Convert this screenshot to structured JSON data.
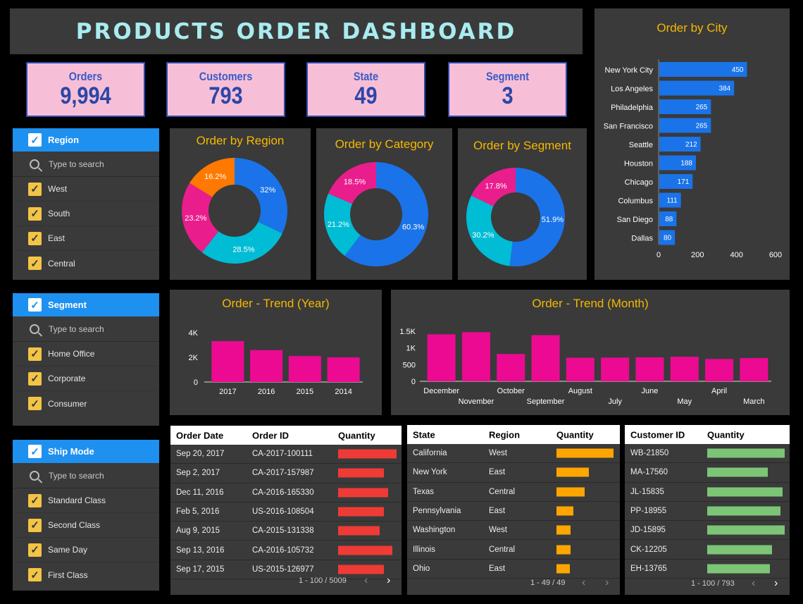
{
  "header": {
    "title": "PRODUCTS ORDER DASHBOARD"
  },
  "kpis": [
    {
      "label": "Orders",
      "value": "9,994"
    },
    {
      "label": "Customers",
      "value": "793"
    },
    {
      "label": "State",
      "value": "49"
    },
    {
      "label": "Segment",
      "value": "3"
    }
  ],
  "filters": {
    "region": {
      "title": "Region",
      "search_placeholder": "Type to search",
      "items": [
        "West",
        "South",
        "East",
        "Central"
      ]
    },
    "segment": {
      "title": "Segment",
      "search_placeholder": "Type to search",
      "items": [
        "Home Office",
        "Corporate",
        "Consumer"
      ]
    },
    "shipmode": {
      "title": "Ship Mode",
      "search_placeholder": "Type to search",
      "items": [
        "Standard Class",
        "Second Class",
        "Same Day",
        "First Class"
      ]
    }
  },
  "colors": {
    "blue": "#1a73e8",
    "teal": "#00bcd4",
    "pink": "#e91e8c",
    "orange": "#ff7900",
    "accent": "#f5b800",
    "bar_pink": "#ec0a93",
    "red_bar": "#ef3b36",
    "orange_bar": "#ffa500",
    "green_bar": "#7cc576"
  },
  "chart_data": [
    {
      "type": "pie",
      "title": "Order by Region",
      "slices": [
        {
          "label": "32%",
          "value": 32,
          "color": "#1a73e8"
        },
        {
          "label": "28.5%",
          "value": 28.5,
          "color": "#00bcd4"
        },
        {
          "label": "23.2%",
          "value": 23.2,
          "color": "#e91e8c"
        },
        {
          "label": "16.2%",
          "value": 16.2,
          "color": "#ff7900"
        }
      ]
    },
    {
      "type": "pie",
      "title": "Order by Category",
      "slices": [
        {
          "label": "60.3%",
          "value": 60.3,
          "color": "#1a73e8"
        },
        {
          "label": "21.2%",
          "value": 21.2,
          "color": "#00bcd4"
        },
        {
          "label": "18.5%",
          "value": 18.5,
          "color": "#e91e8c"
        }
      ]
    },
    {
      "type": "pie",
      "title": "Order by Segment",
      "slices": [
        {
          "label": "51.9%",
          "value": 51.9,
          "color": "#1a73e8"
        },
        {
          "label": "30.2%",
          "value": 30.2,
          "color": "#00bcd4"
        },
        {
          "label": "17.8%",
          "value": 17.8,
          "color": "#e91e8c"
        }
      ]
    },
    {
      "type": "bar",
      "title": "Order by City",
      "orientation": "horizontal",
      "categories": [
        "New York City",
        "Los Angeles",
        "Philadelphia",
        "San Francisco",
        "Seattle",
        "Houston",
        "Chicago",
        "Columbus",
        "San Diego",
        "Dallas"
      ],
      "values": [
        450,
        384,
        265,
        265,
        212,
        188,
        171,
        111,
        88,
        80
      ],
      "xlim": [
        0,
        600
      ],
      "ticks": [
        "0",
        "200",
        "400",
        "600"
      ]
    },
    {
      "type": "bar",
      "title": "Order - Trend (Year)",
      "categories": [
        "2017",
        "2016",
        "2015",
        "2014"
      ],
      "values": [
        3312,
        2587,
        2102,
        1993
      ],
      "ylim": [
        0,
        4000
      ],
      "ticks": [
        "0",
        "2K",
        "4K"
      ]
    },
    {
      "type": "bar",
      "title": "Order - Trend (Month)",
      "categories": [
        "December",
        "November",
        "October",
        "September",
        "August",
        "July",
        "June",
        "May",
        "April",
        "March"
      ],
      "values": [
        1408,
        1471,
        819,
        1383,
        706,
        710,
        717,
        735,
        668,
        696
      ],
      "ylim": [
        0,
        1500
      ],
      "ticks": [
        "0",
        "500",
        "1K",
        "1.5K"
      ]
    }
  ],
  "tables": {
    "orders": {
      "headers": [
        "Order Date",
        "Order ID",
        "Quantity"
      ],
      "rows": [
        [
          "Sep 20, 2017",
          "CA-2017-100111",
          14
        ],
        [
          "Sep 2, 2017",
          "CA-2017-157987",
          11
        ],
        [
          "Dec 11, 2016",
          "CA-2016-165330",
          12
        ],
        [
          "Feb 5, 2016",
          "US-2016-108504",
          11
        ],
        [
          "Aug 9, 2015",
          "CA-2015-131338",
          10
        ],
        [
          "Sep 13, 2016",
          "CA-2016-105732",
          13
        ],
        [
          "Sep 17, 2015",
          "US-2015-126977",
          11
        ]
      ],
      "max": 14,
      "pager": "1 - 100 / 5009"
    },
    "states": {
      "headers": [
        "State",
        "Region",
        "Quantity"
      ],
      "rows": [
        [
          "California",
          "West",
          2001
        ],
        [
          "New York",
          "East",
          1128
        ],
        [
          "Texas",
          "Central",
          985
        ],
        [
          "Pennsylvania",
          "East",
          587
        ],
        [
          "Washington",
          "West",
          506
        ],
        [
          "Illinois",
          "Central",
          492
        ],
        [
          "Ohio",
          "East",
          469
        ]
      ],
      "max": 2001,
      "pager": "1 - 49 / 49"
    },
    "customers": {
      "headers": [
        "Customer ID",
        "Quantity"
      ],
      "rows": [
        [
          "WB-21850",
          37
        ],
        [
          "MA-17560",
          29
        ],
        [
          "JL-15835",
          36
        ],
        [
          "PP-18955",
          35
        ],
        [
          "JD-15895",
          37
        ],
        [
          "CK-12205",
          31
        ],
        [
          "EH-13765",
          30
        ]
      ],
      "max": 37,
      "pager": "1 - 100 / 793"
    }
  }
}
